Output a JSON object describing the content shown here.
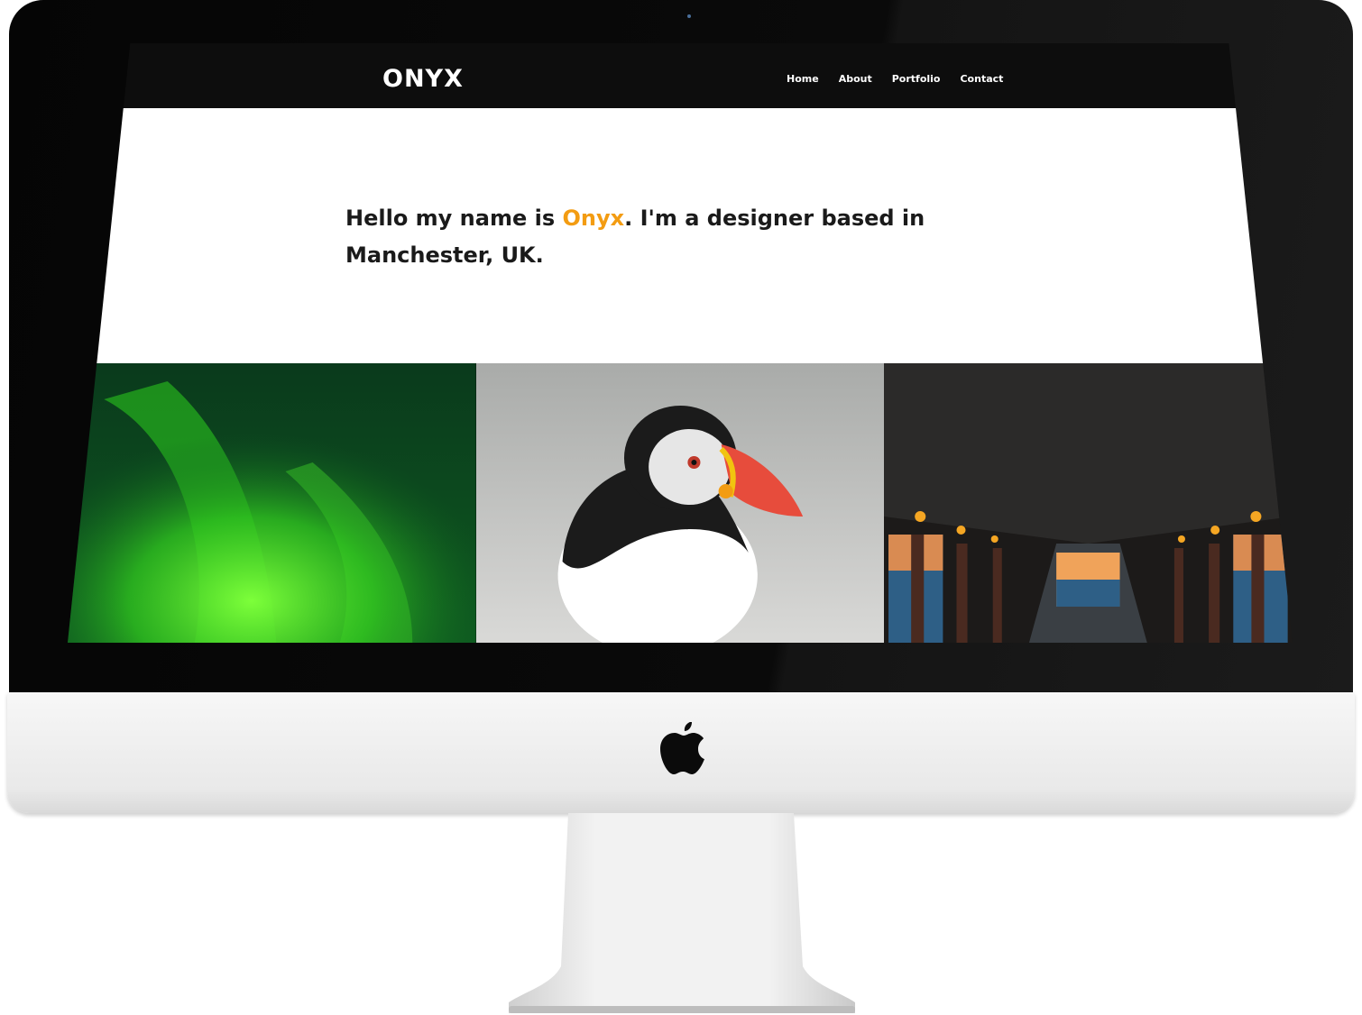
{
  "site": {
    "logo": "ONYX",
    "nav": [
      "Home",
      "About",
      "Portfolio",
      "Contact"
    ]
  },
  "hero": {
    "text_before": "Hello my name is ",
    "name": "Onyx",
    "text_after": ". I'm a designer based in Manchester, UK."
  },
  "colors": {
    "accent": "#f39c12",
    "header_bg": "#0d0d0d"
  },
  "gallery": [
    {
      "subject": "aurora"
    },
    {
      "subject": "puffin"
    },
    {
      "subject": "pier"
    }
  ],
  "icons": {
    "device_logo": "apple-icon"
  }
}
